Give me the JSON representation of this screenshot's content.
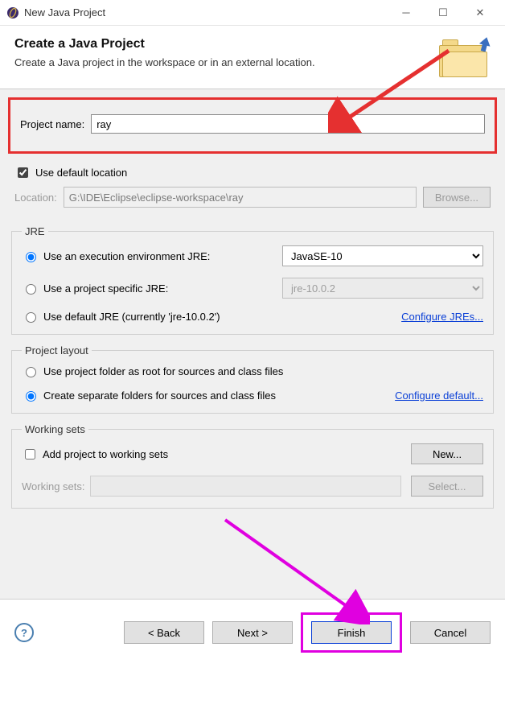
{
  "window": {
    "title": "New Java Project"
  },
  "header": {
    "title": "Create a Java Project",
    "subtitle": "Create a Java project in the workspace or in an external location."
  },
  "project": {
    "name_label": "Project name:",
    "name_value": "ray",
    "use_default_label": "Use default location",
    "location_label": "Location:",
    "location_value": "G:\\IDE\\Eclipse\\eclipse-workspace\\ray",
    "browse_label": "Browse..."
  },
  "jre": {
    "legend": "JRE",
    "opt_env_label": "Use an execution environment JRE:",
    "env_value": "JavaSE-10",
    "opt_specific_label": "Use a project specific JRE:",
    "specific_value": "jre-10.0.2",
    "opt_default_label": "Use default JRE (currently 'jre-10.0.2')",
    "configure_link": "Configure JREs..."
  },
  "layout": {
    "legend": "Project layout",
    "opt_root_label": "Use project folder as root for sources and class files",
    "opt_separate_label": "Create separate folders for sources and class files",
    "configure_link": "Configure default..."
  },
  "ws": {
    "legend": "Working sets",
    "add_label": "Add project to working sets",
    "new_label": "New...",
    "sets_label": "Working sets:",
    "select_label": "Select..."
  },
  "footer": {
    "back": "< Back",
    "next": "Next >",
    "finish": "Finish",
    "cancel": "Cancel"
  }
}
